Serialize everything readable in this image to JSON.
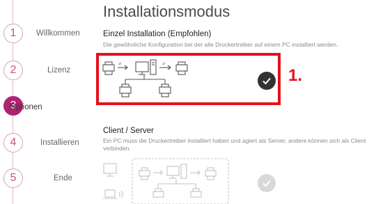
{
  "page": {
    "title": "Installationsmodus"
  },
  "steps": [
    {
      "number": "1",
      "label": "Willkommen",
      "active": false
    },
    {
      "number": "2",
      "label": "Lizenz",
      "active": false
    },
    {
      "number": "3",
      "label": "Optionen",
      "active": true
    },
    {
      "number": "4",
      "label": "Installieren",
      "active": false
    },
    {
      "number": "5",
      "label": "Ende",
      "active": false
    }
  ],
  "options": {
    "single": {
      "title": "Einzel Installation (Empfohlen)",
      "description": "Die gewöhnliche Konfiguration bei der alle Druckertreiber auf einem PC installiert werden.",
      "selected": true
    },
    "client_server": {
      "title": "Client / Server",
      "description": "Ein PC muss die Druckertreiber installiert haben und agiert als Server, andere können sich als Client verbinden.",
      "selected": false
    }
  },
  "annotation": {
    "marker": "1."
  },
  "colors": {
    "accent": "#b0226f",
    "highlight": "#e4111c",
    "check_selected": "#333333",
    "check_unselected": "#d8d8d8"
  }
}
